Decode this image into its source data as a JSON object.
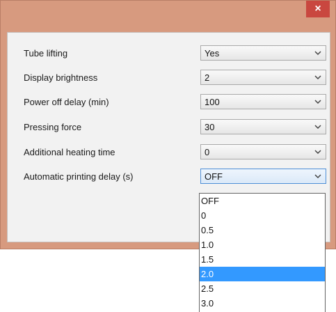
{
  "window": {
    "close_label": "×"
  },
  "settings": [
    {
      "label": "Tube lifting",
      "value": "Yes"
    },
    {
      "label": "Display brightness",
      "value": "2"
    },
    {
      "label": "Power off delay (min)",
      "value": "100"
    },
    {
      "label": "Pressing force",
      "value": "30"
    },
    {
      "label": "Additional heating time",
      "value": "0"
    },
    {
      "label": "Automatic printing delay (s)",
      "value": "OFF"
    }
  ],
  "dropdown": {
    "options": [
      "OFF",
      "0",
      "0.5",
      "1.0",
      "1.5",
      "2.0",
      "2.5",
      "3.0"
    ],
    "highlighted": "2.0"
  },
  "colors": {
    "frame": "#d79a7f",
    "close_button": "#c9473f",
    "highlight": "#3399ff"
  },
  "icons": {
    "select_arrow": "chevron-down-icon",
    "close": "close-icon"
  }
}
